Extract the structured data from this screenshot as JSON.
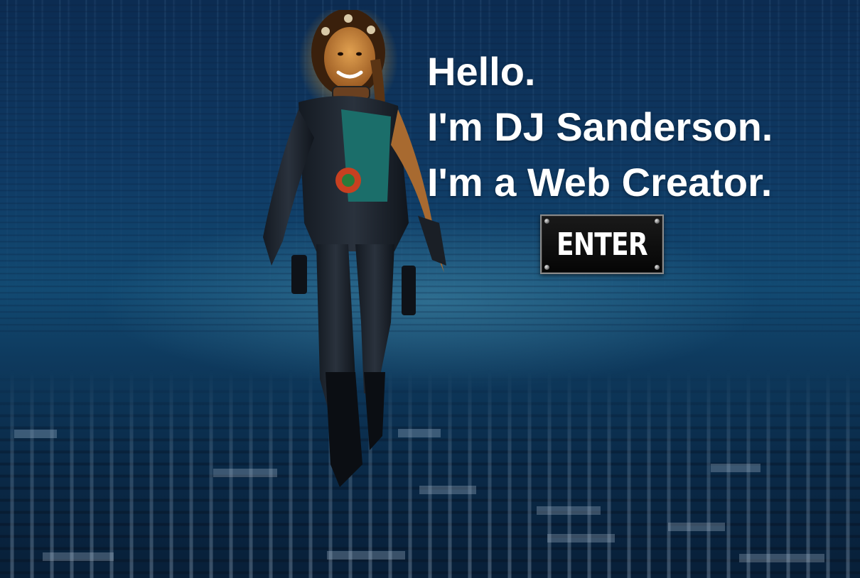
{
  "hero": {
    "lines": [
      "Hello.",
      "I'm DJ Sanderson.",
      "I'm a Web Creator."
    ]
  },
  "enter_button": {
    "label": "ENTER"
  },
  "colors": {
    "background_top": "#0c2c52",
    "background_mid": "#124a72",
    "text": "#ffffff",
    "button_bg": "#050505",
    "button_border": "#8a8a8a"
  }
}
